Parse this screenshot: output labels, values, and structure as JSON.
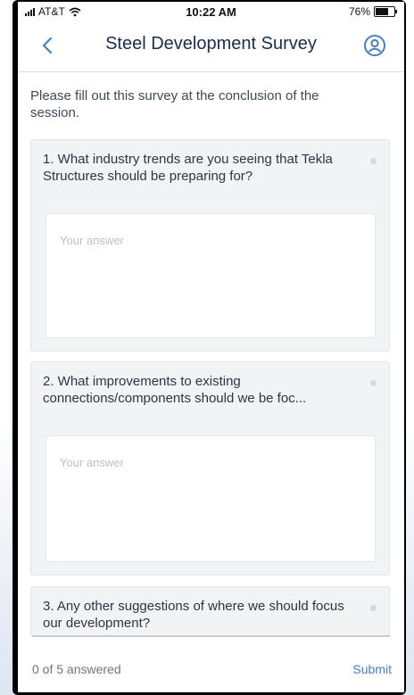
{
  "status_bar": {
    "carrier": "AT&T",
    "time": "10:22 AM",
    "battery": "76%",
    "battery_level": 0.76
  },
  "nav": {
    "title": "Steel Development Survey",
    "back_icon": "chevron-left-icon",
    "profile_icon": "user-circle-icon"
  },
  "intro": "Please fill out this survey at the conclusion of the session.",
  "questions": [
    {
      "text": "1. What industry trends are you seeing that Tekla Structures should be preparing for?",
      "placeholder": "Your answer"
    },
    {
      "text": "2. What improvements to existing connections/components should we be foc...",
      "placeholder": "Your answer"
    },
    {
      "text": "3. Any other suggestions of where we should focus our development?"
    }
  ],
  "footer": {
    "progress": "0 of 5 answered",
    "submit_label": "Submit"
  },
  "colors": {
    "accent": "#4a7fb8",
    "title": "#1b2d47",
    "card_bg": "#f2f3f5"
  }
}
